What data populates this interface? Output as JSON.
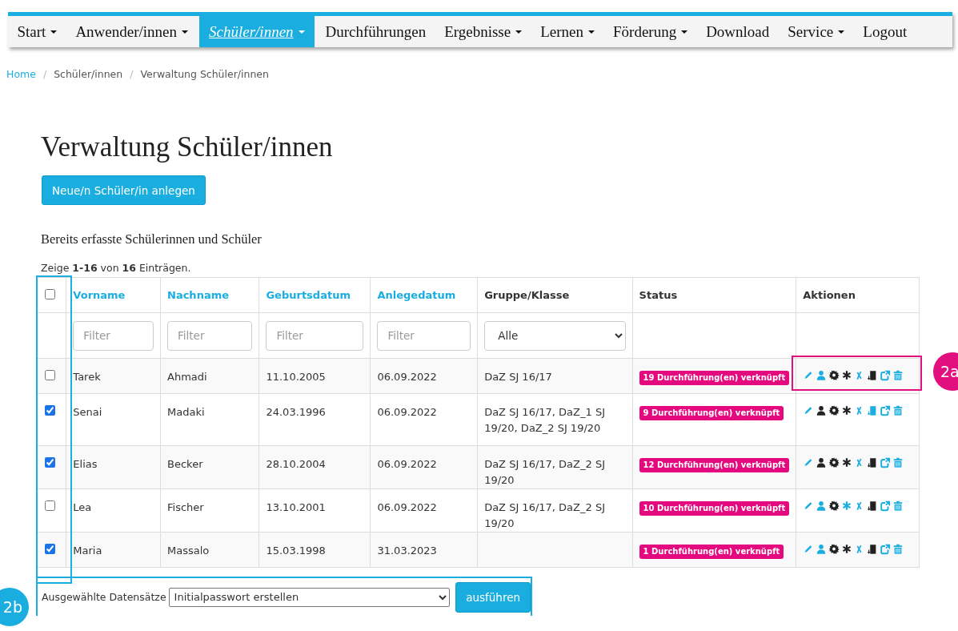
{
  "nav": [
    {
      "label": "Start",
      "dropdown": true,
      "selected": false
    },
    {
      "label": "Anwender/innen",
      "dropdown": true,
      "selected": false
    },
    {
      "label": "Schüler/innen",
      "dropdown": true,
      "selected": true
    },
    {
      "label": "Durchführungen",
      "dropdown": false,
      "selected": false
    },
    {
      "label": "Ergebnisse",
      "dropdown": true,
      "selected": false
    },
    {
      "label": "Lernen",
      "dropdown": true,
      "selected": false
    },
    {
      "label": "Förderung",
      "dropdown": true,
      "selected": false
    },
    {
      "label": "Download",
      "dropdown": false,
      "selected": false
    },
    {
      "label": "Service",
      "dropdown": true,
      "selected": false
    },
    {
      "label": "Logout",
      "dropdown": false,
      "selected": false
    }
  ],
  "breadcrumb": [
    {
      "label": "Home",
      "link": true
    },
    {
      "separator": "/",
      "label": "Schüler/innen",
      "link": false
    },
    {
      "separator": "/",
      "label": "Verwaltung Schüler/innen",
      "link": false
    }
  ],
  "heading": "Verwaltung Schüler/innen",
  "new_button": "Neue/n Schüler/in anlegen",
  "subheading": "Bereits erfasste Schülerinnen und Schüler",
  "summary": "Zeige **1-16** von **16** Einträgen.",
  "table": {
    "select_all": {
      "checked": false
    },
    "columns": [
      {
        "label": "Vorname",
        "sortable": true,
        "filter": {
          "kind": "text",
          "placeholder": "Filter"
        }
      },
      {
        "label": "Nachname",
        "sortable": true,
        "filter": {
          "kind": "text",
          "placeholder": "Filter"
        }
      },
      {
        "label": "Geburtsdatum",
        "sortable": true,
        "filter": {
          "kind": "text",
          "placeholder": "Filter"
        }
      },
      {
        "label": "Anlegedatum",
        "sortable": true,
        "filter": {
          "kind": "text",
          "placeholder": "Filter"
        }
      },
      {
        "label": "Gruppe/Klasse",
        "sortable": false,
        "filter": {
          "kind": "select",
          "value": "Alle"
        }
      },
      {
        "label": "Status",
        "sortable": false
      },
      {
        "label": "Aktionen",
        "sortable": false
      }
    ],
    "rows": [
      {
        "selected": false,
        "cells": [
          "Tarek",
          "Ahmadi",
          "11.10.2005",
          "06.09.2022",
          "DaZ SJ 16/17"
        ],
        "status": "19 Durchführung(en) verknüpft",
        "actions": [
          {
            "kind": "pencil",
            "color": "#1aaee0"
          },
          {
            "kind": "user",
            "color": "#1aaee0"
          },
          {
            "kind": "gear",
            "color": "#222222"
          },
          {
            "kind": "asterisk",
            "color": "#222222"
          },
          {
            "kind": "x",
            "color": "#1aaee0"
          },
          {
            "kind": "door",
            "color": "#222222"
          },
          {
            "kind": "share",
            "color": "#1aaee0"
          },
          {
            "kind": "trash",
            "color": "#1aaee0"
          }
        ]
      },
      {
        "selected": true,
        "cells": [
          "Senai",
          "Madaki",
          "24.03.1996",
          "06.09.2022",
          "DaZ SJ 16/17, DaZ_1 SJ 19/20, DaZ_2 SJ 19/20"
        ],
        "status": "9 Durchführung(en) verknüpft",
        "actions": [
          {
            "kind": "pencil",
            "color": "#1aaee0"
          },
          {
            "kind": "user",
            "color": "#222222"
          },
          {
            "kind": "gear",
            "color": "#222222"
          },
          {
            "kind": "asterisk",
            "color": "#222222"
          },
          {
            "kind": "x",
            "color": "#1aaee0"
          },
          {
            "kind": "door",
            "color": "#1aaee0"
          },
          {
            "kind": "share",
            "color": "#1aaee0"
          },
          {
            "kind": "trash",
            "color": "#1aaee0"
          }
        ]
      },
      {
        "selected": true,
        "cells": [
          "Elias",
          "Becker",
          "28.10.2004",
          "06.09.2022",
          "DaZ SJ 16/17, DaZ_2 SJ 19/20"
        ],
        "status": "12 Durchführung(en) verknüpft",
        "actions": [
          {
            "kind": "pencil",
            "color": "#1aaee0"
          },
          {
            "kind": "user",
            "color": "#222222"
          },
          {
            "kind": "gear",
            "color": "#222222"
          },
          {
            "kind": "asterisk",
            "color": "#222222"
          },
          {
            "kind": "x",
            "color": "#1aaee0"
          },
          {
            "kind": "door",
            "color": "#222222"
          },
          {
            "kind": "share",
            "color": "#1aaee0"
          },
          {
            "kind": "trash",
            "color": "#1aaee0"
          }
        ]
      },
      {
        "selected": false,
        "cells": [
          "Lea",
          "Fischer",
          "13.10.2001",
          "06.09.2022",
          "DaZ SJ 16/17, DaZ_2 SJ 19/20"
        ],
        "status": "10 Durchführung(en) verknüpft",
        "actions": [
          {
            "kind": "pencil",
            "color": "#1aaee0"
          },
          {
            "kind": "user",
            "color": "#1aaee0"
          },
          {
            "kind": "gear",
            "color": "#222222"
          },
          {
            "kind": "asterisk",
            "color": "#1aaee0"
          },
          {
            "kind": "x",
            "color": "#1aaee0"
          },
          {
            "kind": "door",
            "color": "#222222"
          },
          {
            "kind": "share",
            "color": "#1aaee0"
          },
          {
            "kind": "trash",
            "color": "#1aaee0"
          }
        ]
      },
      {
        "selected": true,
        "cells": [
          "Maria",
          "Massalo",
          "15.03.1998",
          "31.03.2023",
          ""
        ],
        "status": "1 Durchführung(en) verknüpft",
        "actions": [
          {
            "kind": "pencil",
            "color": "#1aaee0"
          },
          {
            "kind": "user",
            "color": "#1aaee0"
          },
          {
            "kind": "gear",
            "color": "#222222"
          },
          {
            "kind": "asterisk",
            "color": "#222222"
          },
          {
            "kind": "x",
            "color": "#1aaee0"
          },
          {
            "kind": "door",
            "color": "#222222"
          },
          {
            "kind": "share",
            "color": "#1aaee0"
          },
          {
            "kind": "trash",
            "color": "#1aaee0"
          }
        ]
      }
    ]
  },
  "bulk": {
    "label": "Ausgewählte Datensätze",
    "value": "Initialpasswort erstellen",
    "button": "ausführen"
  },
  "annotations": [
    {
      "label": "2a",
      "color": "#e2107f"
    },
    {
      "label": "2b",
      "color": "#1aaee0"
    }
  ]
}
